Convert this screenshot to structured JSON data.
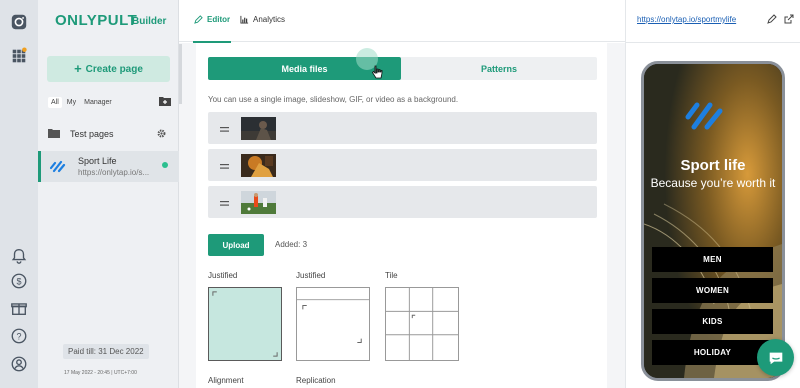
{
  "brand": {
    "logo": "ONLYPULT",
    "logo_sub": "Builder",
    "accent": "#1e9a79"
  },
  "sidebar": {
    "create_button": "Create page",
    "filters": [
      "All",
      "My",
      "Manager"
    ],
    "folder": {
      "label": "Test pages"
    },
    "page_item": {
      "title": "Sport Life",
      "url": "https://onlytap.io/s..."
    },
    "paid_till": "Paid till: 31 Dec 2022",
    "timestamp": "17 May 2022 - 20:45 | UTC+7:00"
  },
  "rail_icons": [
    "camera-icon",
    "apps-grid-icon",
    "bell-icon",
    "dollar-icon",
    "gift-icon",
    "help-icon",
    "user-icon"
  ],
  "topbar": {
    "tabs": [
      {
        "label": "Editor",
        "active": true
      },
      {
        "label": "Analytics",
        "active": false
      }
    ]
  },
  "editor": {
    "segments": {
      "media": "Media files",
      "patterns": "Patterns"
    },
    "hint": "You can use a single image, slideshow, GIF, or video as a background.",
    "media_items": [
      {
        "thumb": "dark-athlete"
      },
      {
        "thumb": "runner-orange"
      },
      {
        "thumb": "soccer-field"
      }
    ],
    "upload_label": "Upload",
    "added_label": "Added: 3",
    "layouts": [
      "Justified",
      "Justified",
      "Tile"
    ],
    "bottom_labels": [
      "Alignment",
      "Replication"
    ]
  },
  "preview": {
    "url": "https://onlytap.io/sportmylife",
    "phone": {
      "title": "Sport life",
      "subtitle": "Because you’re worth it",
      "buttons": [
        "MEN",
        "WOMEN",
        "KIDS",
        "HOLIDAY"
      ]
    }
  }
}
